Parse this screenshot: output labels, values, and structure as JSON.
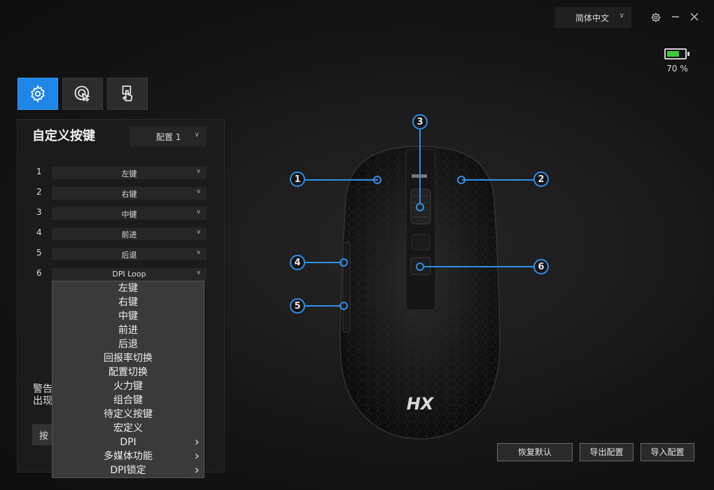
{
  "topbar": {
    "language": "简体中文"
  },
  "battery": {
    "percent_text": "70 %",
    "level": 0.7,
    "fill_color": "#3fc83f"
  },
  "tabs": [
    {
      "icon": "gear-icon",
      "active": true
    },
    {
      "icon": "cursor-click-icon",
      "active": false
    },
    {
      "icon": "touch-hand-icon",
      "active": false
    }
  ],
  "panel": {
    "title": "自定义按键",
    "profile": "配置 1",
    "rows": [
      {
        "num": "1",
        "value": "左键"
      },
      {
        "num": "2",
        "value": "右键"
      },
      {
        "num": "3",
        "value": "中键"
      },
      {
        "num": "4",
        "value": "前进"
      },
      {
        "num": "5",
        "value": "后退"
      },
      {
        "num": "6",
        "value": "DPI Loop"
      }
    ],
    "warning_line1": "警告",
    "warning_line2": "出现",
    "warning_button": "按"
  },
  "dropdown": {
    "items": [
      {
        "label": "左键",
        "submenu": false
      },
      {
        "label": "右键",
        "submenu": false
      },
      {
        "label": "中键",
        "submenu": false
      },
      {
        "label": "前进",
        "submenu": false
      },
      {
        "label": "后退",
        "submenu": false
      },
      {
        "label": "回报率切换",
        "submenu": false
      },
      {
        "label": "配置切换",
        "submenu": false
      },
      {
        "label": "火力键",
        "submenu": false
      },
      {
        "label": "组合键",
        "submenu": false
      },
      {
        "label": "待定义按键",
        "submenu": false
      },
      {
        "label": "宏定义",
        "submenu": false
      },
      {
        "label": "DPI",
        "submenu": true
      },
      {
        "label": "多媒体功能",
        "submenu": true
      },
      {
        "label": "DPI锁定",
        "submenu": true
      }
    ]
  },
  "mouse": {
    "callouts": [
      "1",
      "2",
      "3",
      "4",
      "5",
      "6"
    ],
    "accent": "#2f8ee8",
    "brand": "HX"
  },
  "footer": {
    "reset": "恢复默认",
    "export": "导出配置",
    "import": "导入配置"
  }
}
